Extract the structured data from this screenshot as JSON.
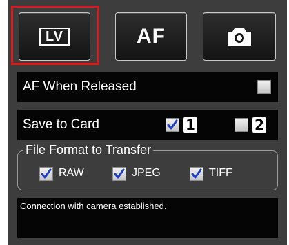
{
  "top_buttons": {
    "lv": {
      "label": "LV",
      "icon": "live-view-icon",
      "highlight_color": "#d81c1c"
    },
    "af": {
      "label": "AF"
    },
    "camera": {
      "icon": "camera-icon"
    }
  },
  "af_when_released": {
    "label": "AF When Released",
    "checked": false
  },
  "save_to_card": {
    "label": "Save to Card",
    "cards": [
      {
        "number": "1",
        "checked": true
      },
      {
        "number": "2",
        "checked": false
      }
    ]
  },
  "file_format": {
    "legend": "File Format to Transfer",
    "options": [
      {
        "label": "RAW",
        "checked": true
      },
      {
        "label": "JPEG",
        "checked": true
      },
      {
        "label": "TIFF",
        "checked": true
      }
    ]
  },
  "status": {
    "text": "Connection with camera established."
  },
  "colors": {
    "panel": "#3d3d3d",
    "row": "#050505",
    "check": "#1f3fc2"
  }
}
